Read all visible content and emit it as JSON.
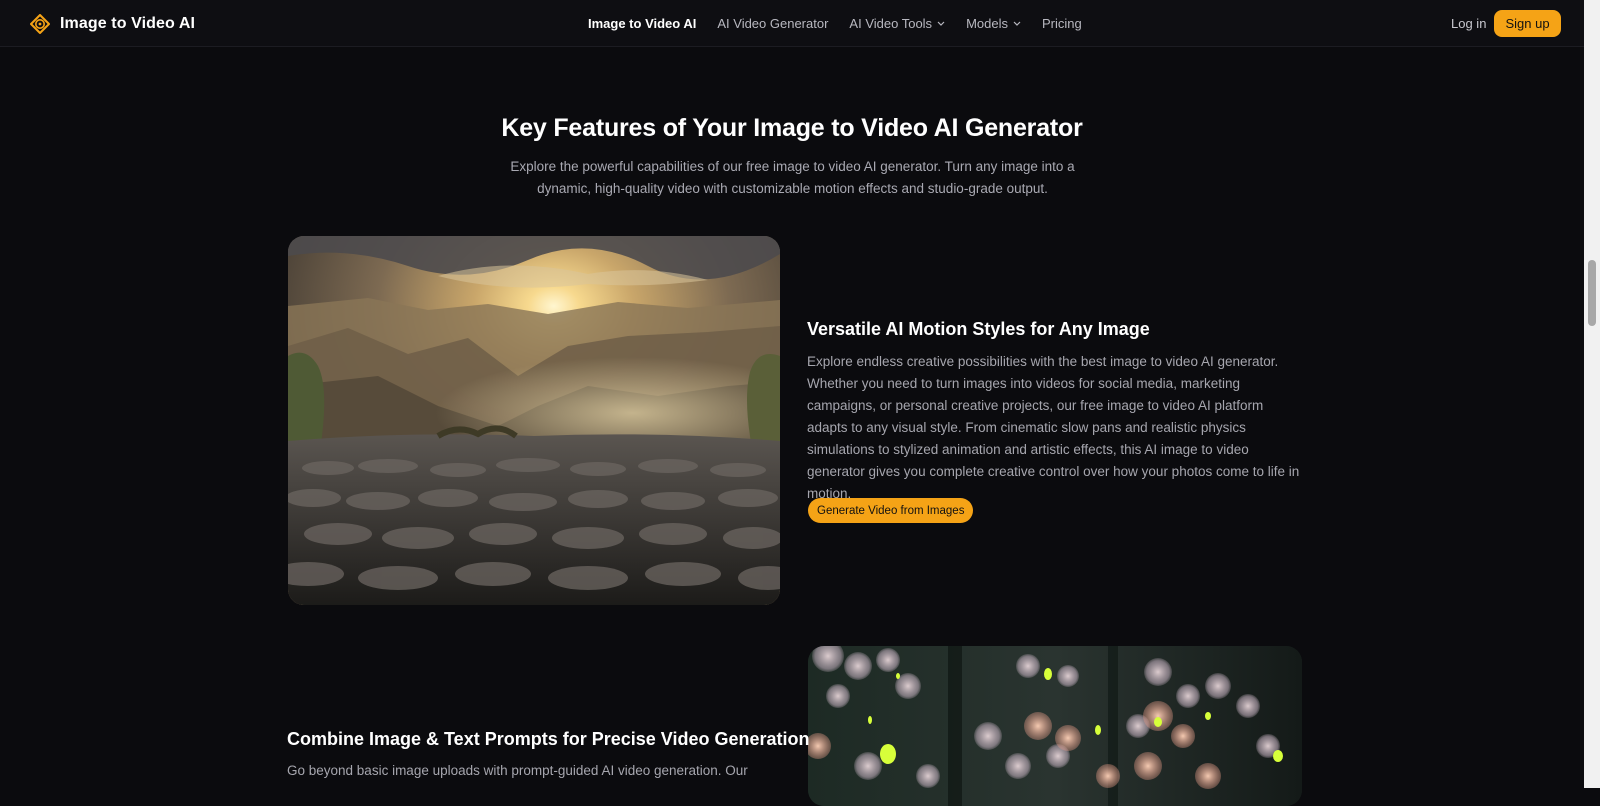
{
  "header": {
    "brand": "Image to Video AI",
    "nav": [
      {
        "label": "Image to Video AI",
        "active": true,
        "dropdown": false
      },
      {
        "label": "AI Video Generator",
        "active": false,
        "dropdown": false
      },
      {
        "label": "AI Video Tools",
        "active": false,
        "dropdown": true
      },
      {
        "label": "Models",
        "active": false,
        "dropdown": true
      },
      {
        "label": "Pricing",
        "active": false,
        "dropdown": false
      }
    ],
    "login": "Log in",
    "signup": "Sign up"
  },
  "section": {
    "title": "Key Features of Your Image to Video AI Generator",
    "subtitle": "Explore the powerful capabilities of our free image to video AI generator. Turn any image into a dynamic, high-quality video with customizable motion effects and studio-grade output."
  },
  "features": [
    {
      "title": "Versatile AI Motion Styles for Any Image",
      "body": "Explore endless creative possibilities with the best image to video AI generator. Whether you need to turn images into videos for social media, marketing campaigns, or personal creative projects, our free image to video AI platform adapts to any visual style. From cinematic slow pans and realistic physics simulations to stylized animation and artistic effects, this AI image to video generator gives you complete creative control over how your photos come to life in motion.",
      "cta": "Generate Video from Images"
    },
    {
      "title": "Combine Image & Text Prompts for Precise Video Generation",
      "body": "Go beyond basic image uploads with prompt-guided AI video generation. Our"
    }
  ],
  "colors": {
    "accent": "#f5a316",
    "background": "#0b0b0e",
    "header_bg": "#0e0e12"
  }
}
